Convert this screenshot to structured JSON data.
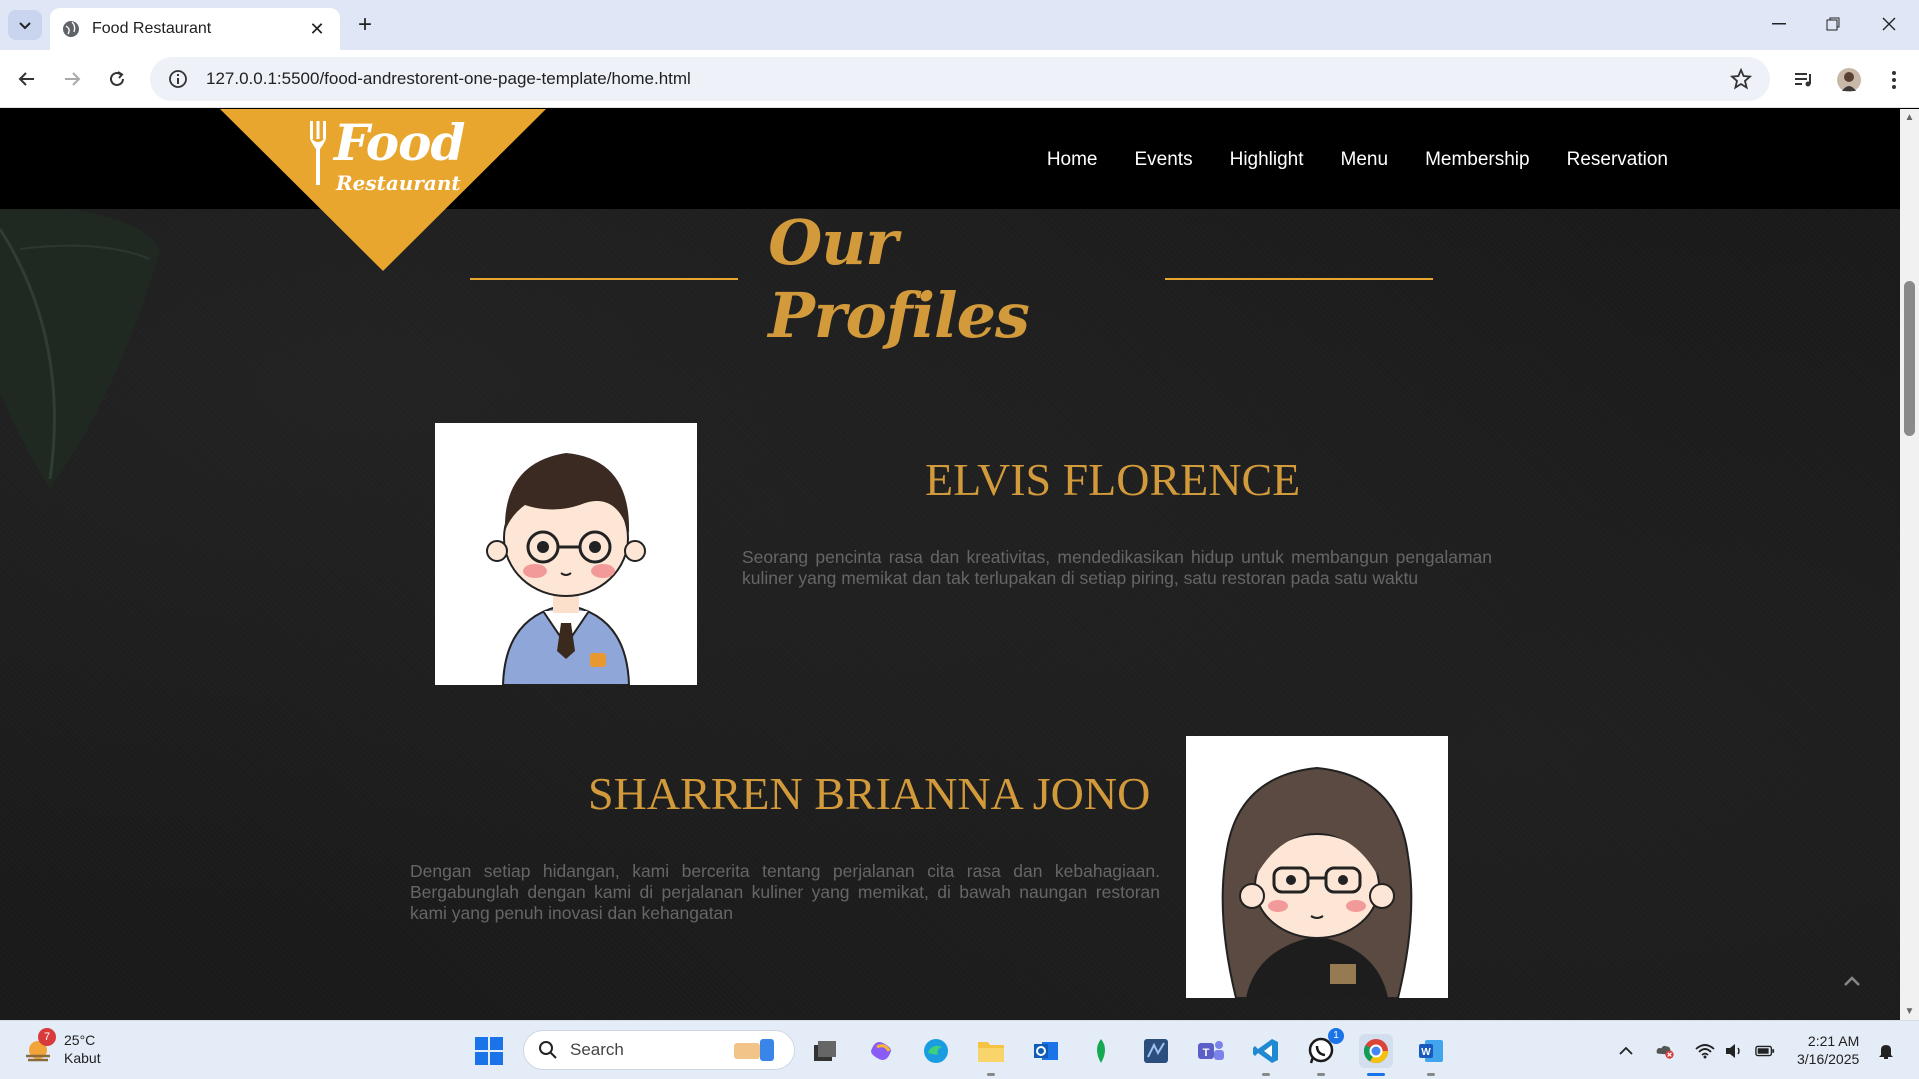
{
  "browser": {
    "tab_title": "Food Restaurant",
    "url": "127.0.0.1:5500/food-andrestorent-one-page-template/home.html"
  },
  "site": {
    "logo_word1": "Food",
    "logo_word2": "Restaurant",
    "nav": [
      "Home",
      "Events",
      "Highlight",
      "Menu",
      "Membership",
      "Reservation"
    ],
    "section_title": "Our Profiles",
    "profiles": [
      {
        "name": "ELVIS FLORENCE",
        "description": "Seorang pencinta rasa dan kreativitas, mendedikasikan hidup untuk membangun pengalaman kuliner yang memikat dan tak terlupakan di setiap piring, satu restoran pada satu waktu"
      },
      {
        "name": "SHARREN BRIANNA JONO",
        "description": "Dengan setiap hidangan, kami bercerita tentang perjalanan cita rasa dan kebahagiaan. Bergabunglah dengan kami di perjalanan kuliner yang memikat, di bawah naungan restoran kami yang penuh inovasi dan kehangatan"
      }
    ]
  },
  "taskbar": {
    "weather_temp": "25°C",
    "weather_desc": "Kabut",
    "weather_badge": "7",
    "search_label": "Search",
    "whatsapp_badge": "1",
    "time": "2:21 AM",
    "date": "3/16/2025"
  },
  "colors": {
    "accent": "#e9a62f",
    "title_gold": "#d29a3a",
    "header_bg": "#000000"
  }
}
